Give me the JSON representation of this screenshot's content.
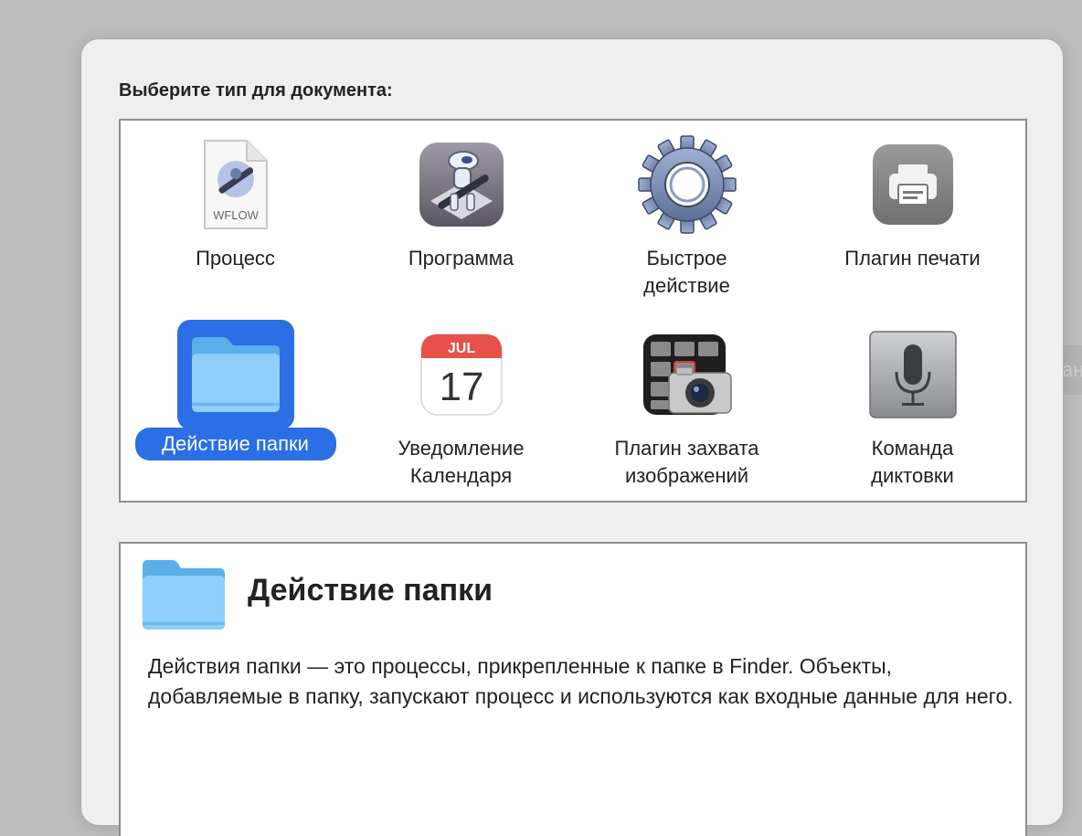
{
  "background": {
    "ghost_text": "ан"
  },
  "dialog": {
    "prompt": "Выберите тип для документа:",
    "accent_color": "#2b6ee6",
    "document_types": [
      {
        "label": "Процесс",
        "icon": "workflow-file-icon",
        "icon_text": "WFLOW",
        "selected": false
      },
      {
        "label": "Программа",
        "icon": "automator-robot-icon",
        "selected": false
      },
      {
        "label": "Быстрое\nдействие",
        "icon": "gear-icon",
        "selected": false
      },
      {
        "label": "Плагин печати",
        "icon": "printer-icon",
        "selected": false
      },
      {
        "label": "Действие папки",
        "icon": "folder-icon",
        "selected": true
      },
      {
        "label": "Уведомление\nКалендаря",
        "icon": "calendar-icon",
        "calendar_month": "JUL",
        "calendar_day": "17",
        "selected": false
      },
      {
        "label": "Плагин захвата\nизображений",
        "icon": "image-capture-icon",
        "selected": false
      },
      {
        "label": "Команда\nдиктовки",
        "icon": "microphone-icon",
        "selected": false
      }
    ],
    "description": {
      "icon": "folder-icon",
      "title": "Действие папки",
      "text": "Действия папки — это процессы, прикрепленные к папке в Finder. Объекты, добавляемые в папку, запускают процесс и используются как входные данные для него."
    }
  }
}
